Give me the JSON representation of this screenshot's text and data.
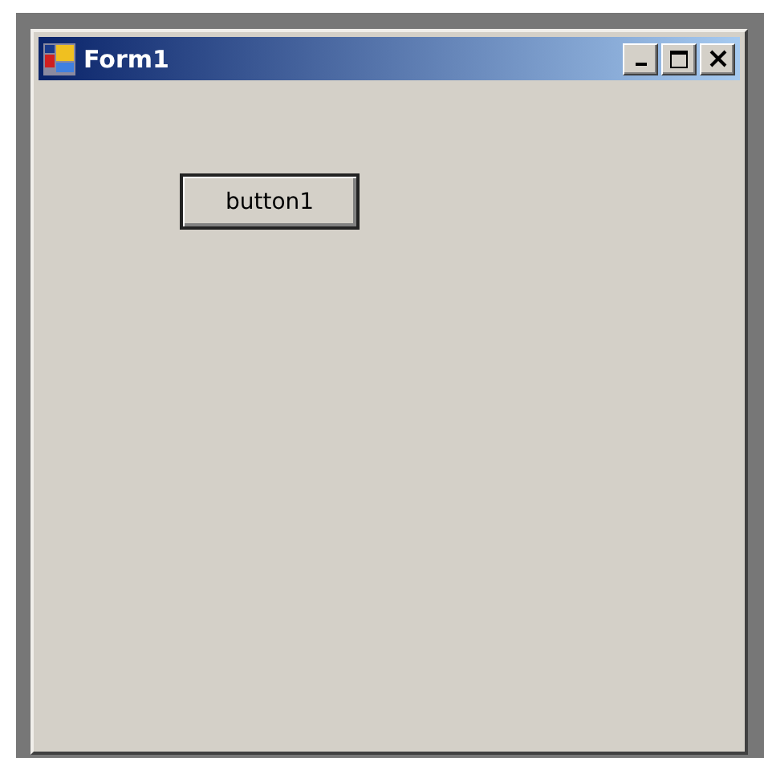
{
  "window": {
    "title": "Form1",
    "controls": [
      {
        "kind": "minimize"
      },
      {
        "kind": "maximize"
      },
      {
        "kind": "close"
      }
    ]
  },
  "button": {
    "label": "button1"
  }
}
